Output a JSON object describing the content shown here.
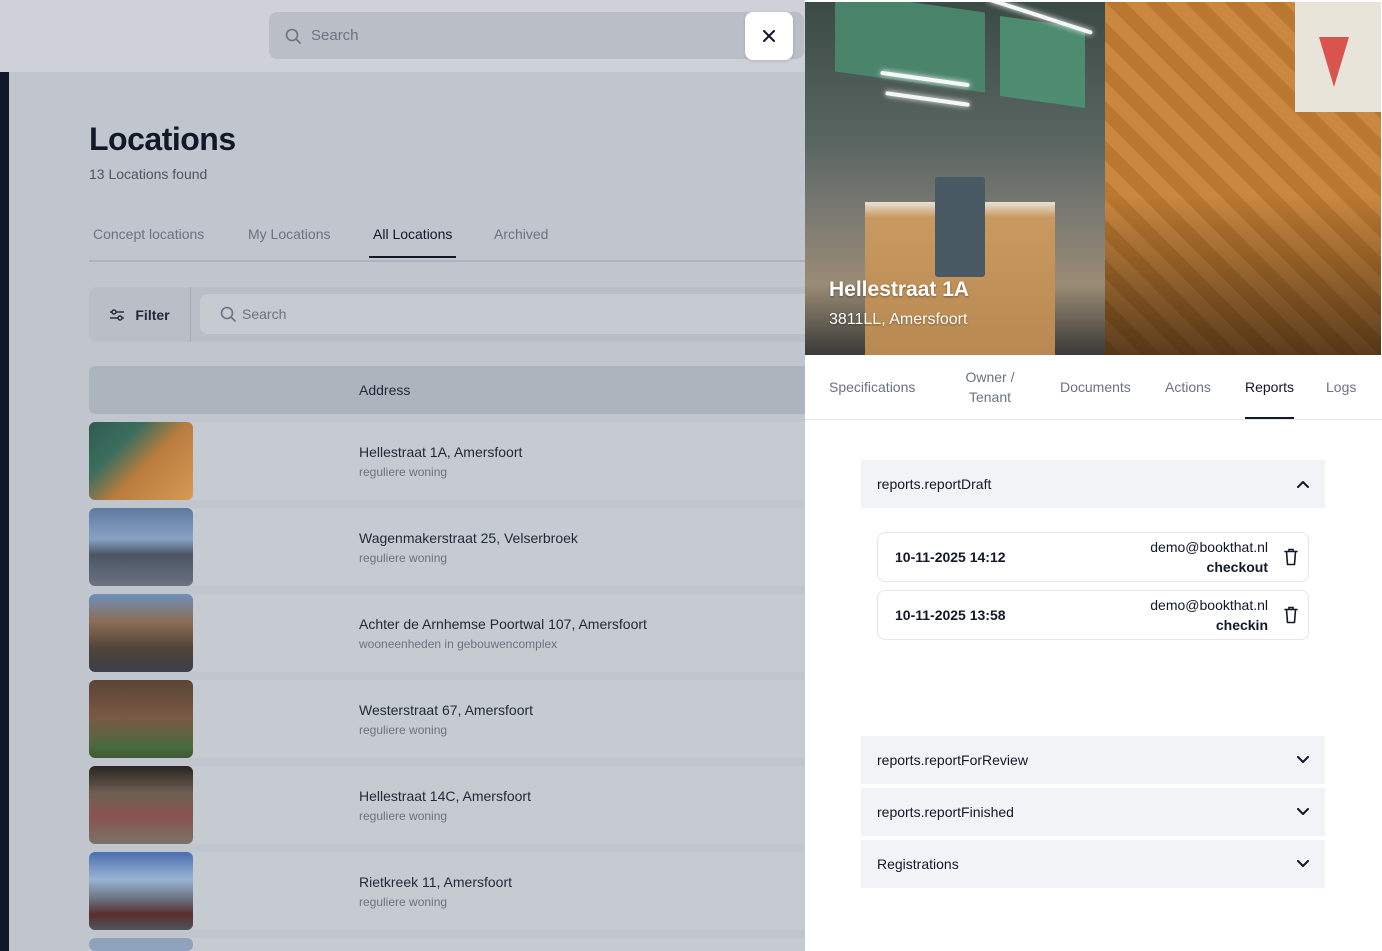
{
  "top_search": {
    "placeholder": "Search"
  },
  "page": {
    "title": "Locations",
    "count": "13 Locations found",
    "tabs": [
      "Concept locations",
      "My Locations",
      "All Locations",
      "Archived"
    ],
    "active_tab": "All Locations"
  },
  "toolbar": {
    "filter_label": "Filter",
    "search_placeholder": "Search"
  },
  "table": {
    "header_address": "Address",
    "rows": [
      {
        "address": "Hellestraat 1A, Amersfoort",
        "kind": "reguliere woning"
      },
      {
        "address": "Wagenmakerstraat 25, Velserbroek",
        "kind": "reguliere woning"
      },
      {
        "address": "Achter de Arnhemse Poortwal 107, Amersfoort",
        "kind": "wooneenheden in gebouwencomplex"
      },
      {
        "address": "Westerstraat 67, Amersfoort",
        "kind": "reguliere woning"
      },
      {
        "address": "Hellestraat 14C, Amersfoort",
        "kind": "reguliere woning"
      },
      {
        "address": "Rietkreek 11, Amersfoort",
        "kind": "reguliere woning"
      }
    ]
  },
  "panel": {
    "title": "Hellestraat 1A",
    "subtitle": "3811LL, Amersfoort",
    "tabs": [
      "Specifications",
      "Owner / Tenant",
      "Documents",
      "Actions",
      "Reports",
      "Logs"
    ],
    "active_tab": "Reports",
    "sections": {
      "draft": {
        "label": "reports.reportDraft",
        "expanded": true
      },
      "review": {
        "label": "reports.reportForReview",
        "expanded": false
      },
      "finished": {
        "label": "reports.reportFinished",
        "expanded": false
      },
      "registrations": {
        "label": "Registrations",
        "expanded": false
      }
    },
    "draft_reports": [
      {
        "date": "10-11-2025 14:12",
        "user": "demo@bookthat.nl",
        "type": "checkout"
      },
      {
        "date": "10-11-2025 13:58",
        "user": "demo@bookthat.nl",
        "type": "checkin"
      }
    ]
  },
  "colors": {
    "overlay": "#c1c6ce",
    "panel_bg": "#ffffff",
    "accordion_bg": "#f1f3f6",
    "text": "#111827",
    "muted": "#6b7280"
  },
  "icons": [
    "search-icon",
    "close-icon",
    "filter-icon",
    "chevron-up-icon",
    "chevron-down-icon",
    "trash-icon"
  ]
}
